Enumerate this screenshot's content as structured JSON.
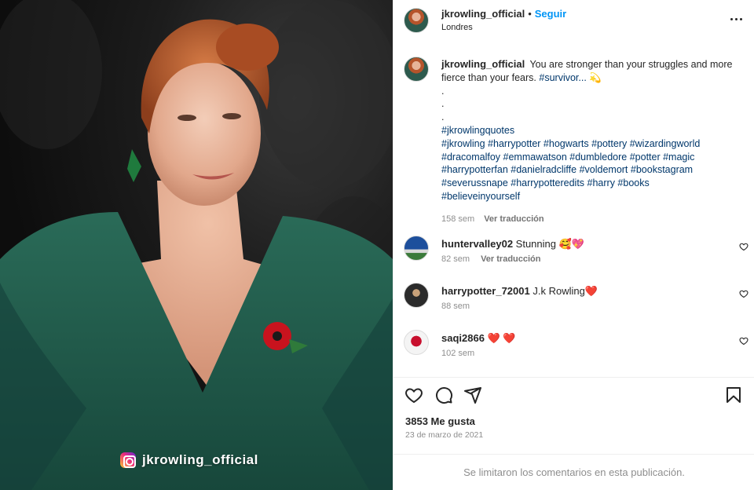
{
  "photo": {
    "watermark_text": "jkrowling_official"
  },
  "header": {
    "username": "jkrowling_official",
    "separator": "•",
    "follow_label": "Seguir",
    "location": "Londres"
  },
  "caption": {
    "username": "jkrowling_official",
    "text": "You are stronger than your struggles and more fierce than your fears.",
    "first_tag": "#survivor...",
    "emoji": "💫",
    "dots": [
      ".",
      ".",
      "."
    ],
    "tag_lines": [
      "#jkrowlingquotes",
      "#jkrowling #harrypotter #hogwarts #pottery #wizardingworld",
      "#dracomalfoy #emmawatson #dumbledore #potter #magic",
      "#harrypotterfan #danielradcliffe #voldemort #bookstagram",
      "#severussnape #harrypotteredits #harry #books",
      "#believeinyourself"
    ],
    "age": "158 sem",
    "translate_label": "Ver traducción"
  },
  "comments": [
    {
      "username": "huntervalley02",
      "text": "Stunning 🥰💖",
      "age": "82 sem",
      "translate_label": "Ver traducción"
    },
    {
      "username": "harrypotter_72001",
      "text": "J.k Rowling❤️",
      "age": "88 sem",
      "translate_label": ""
    },
    {
      "username": "saqi2866",
      "text": "❤️ ❤️",
      "age": "102 sem",
      "translate_label": ""
    }
  ],
  "likes": "3853 Me gusta",
  "date": "23 de marzo de 2021",
  "footer_notice": "Se limitaron los comentarios en esta publicación.",
  "icons": {
    "like": "heart-icon",
    "comment": "comment-icon",
    "share": "share-icon",
    "save": "bookmark-icon",
    "more": "more-icon"
  },
  "colors": {
    "follow": "#0095f6",
    "hashtag": "#00376b",
    "muted": "#8e8e8e",
    "dress": "#1f5c4a"
  }
}
